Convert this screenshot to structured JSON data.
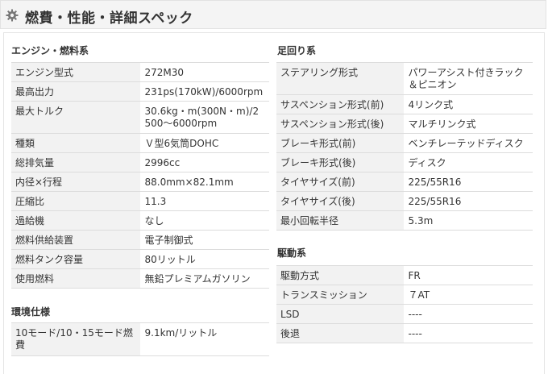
{
  "header": {
    "icon": "gear-icon",
    "title": "燃費・性能・詳細スペック"
  },
  "engine": {
    "title": "エンジン・燃料系",
    "rows": [
      {
        "label": "エンジン型式",
        "value": "272M30"
      },
      {
        "label": "最高出力",
        "value": "231ps(170kW)/6000rpm"
      },
      {
        "label": "最大トルク",
        "value": "30.6kg・m(300N・m)/2\n500～6000rpm"
      },
      {
        "label": "種類",
        "value": "Ｖ型6気筒DOHC"
      },
      {
        "label": "総排気量",
        "value": "2996cc"
      },
      {
        "label": "内径×行程",
        "value": "88.0mm×82.1mm"
      },
      {
        "label": "圧縮比",
        "value": "11.3"
      },
      {
        "label": "過給機",
        "value": "なし"
      },
      {
        "label": "燃料供給装置",
        "value": "電子制御式"
      },
      {
        "label": "燃料タンク容量",
        "value": "80リットル"
      },
      {
        "label": "使用燃料",
        "value": "無鉛プレミアムガソリン"
      }
    ]
  },
  "environment": {
    "title": "環境仕様",
    "rows": [
      {
        "label": "10モード/10・15モード燃\n費",
        "value": "9.1km/リットル"
      }
    ]
  },
  "chassis": {
    "title": "足回り系",
    "rows": [
      {
        "label": "ステアリング形式",
        "value": "パワーアシスト付きラック\n＆ピニオン"
      },
      {
        "label": "サスペンション形式(前)",
        "value": "4リンク式"
      },
      {
        "label": "サスペンション形式(後)",
        "value": "マルチリンク式"
      },
      {
        "label": "ブレーキ形式(前)",
        "value": "ベンチレーテッドディスク"
      },
      {
        "label": "ブレーキ形式(後)",
        "value": "ディスク"
      },
      {
        "label": "タイヤサイズ(前)",
        "value": "225/55R16"
      },
      {
        "label": "タイヤサイズ(後)",
        "value": "225/55R16"
      },
      {
        "label": "最小回転半径",
        "value": "5.3m"
      }
    ]
  },
  "drivetrain": {
    "title": "駆動系",
    "rows": [
      {
        "label": "駆動方式",
        "value": "FR"
      },
      {
        "label": "トランスミッション",
        "value": "７AT"
      },
      {
        "label": "LSD",
        "value": "----"
      },
      {
        "label": "後退",
        "value": "----"
      }
    ]
  }
}
